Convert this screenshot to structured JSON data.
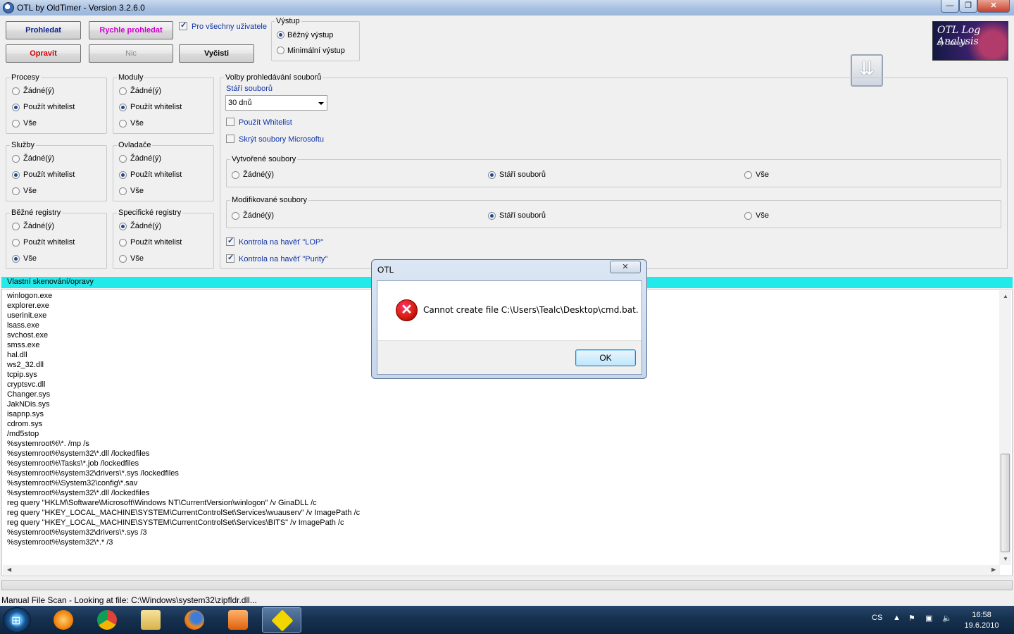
{
  "window": {
    "title": "OTL by OldTimer - Version 3.2.6.0",
    "min": "—",
    "max": "❐",
    "close": "✕"
  },
  "toolbar": {
    "prohledat": "Prohledat",
    "rychle": "Rychle prohledat",
    "opravit": "Opravit",
    "nic": "Nic",
    "vycisti": "Vyčisti",
    "all_users_label": "Pro všechny uživatele",
    "all_users_checked": true
  },
  "vystup": {
    "title": "Výstup",
    "normal": "Běžný výstup",
    "minimal": "Minimální výstup",
    "selected": "normal"
  },
  "logo": {
    "line1": "OTL Log Analysis",
    "line2": "By Oldtimer"
  },
  "groups": {
    "procesy": {
      "title": "Procesy",
      "options": [
        "Žádné(ý)",
        "Použít whitelist",
        "Vše"
      ],
      "selected": 1
    },
    "moduly": {
      "title": "Moduly",
      "options": [
        "Žádné(ý)",
        "Použít whitelist",
        "Vše"
      ],
      "selected": 1
    },
    "sluzby": {
      "title": "Služby",
      "options": [
        "Žádné(ý)",
        "Použít whitelist",
        "Vše"
      ],
      "selected": 1
    },
    "ovladace": {
      "title": "Ovladače",
      "options": [
        "Žádné(ý)",
        "Použít whitelist",
        "Vše"
      ],
      "selected": 1
    },
    "bezne": {
      "title": "Běžné registry",
      "options": [
        "Žádné(ý)",
        "Použít whitelist",
        "Vše"
      ],
      "selected": 2
    },
    "specificke": {
      "title": "Specifické registry",
      "options": [
        "Žádné(ý)",
        "Použít whitelist",
        "Vše"
      ],
      "selected": 0
    }
  },
  "file_scan": {
    "title": "Volby prohledávání souborů",
    "age_label": "Stáří souborů",
    "age_value": "30 dnů",
    "use_whitelist": "Použít Whitelist",
    "hide_ms": "Skrýt soubory Microsoftu",
    "created": {
      "title": "Vytvořené soubory",
      "options": [
        "Žádné(ý)",
        "Stáří souborů",
        "Vše"
      ],
      "selected": 1
    },
    "modified": {
      "title": "Modifikované soubory",
      "options": [
        "Žádné(ý)",
        "Stáří souborů",
        "Vše"
      ],
      "selected": 1
    },
    "lop": "Kontrola na havěť \"LOP\"",
    "purity": "Kontrola na havěť \"Purity\""
  },
  "custom_scan": {
    "title": "Vlastní skenování/opravy",
    "lines": [
      "winlogon.exe",
      "explorer.exe",
      "userinit.exe",
      "lsass.exe",
      "svchost.exe",
      "smss.exe",
      "hal.dll",
      "ws2_32.dll",
      "tcpip.sys",
      "cryptsvc.dll",
      "Changer.sys",
      "JakNDis.sys",
      "isapnp.sys",
      "cdrom.sys",
      "/md5stop",
      "%systemroot%\\*. /mp /s",
      "%systemroot%\\system32\\*.dll /lockedfiles",
      "%systemroot%\\Tasks\\*.job /lockedfiles",
      "%systemroot%\\system32\\drivers\\*.sys /lockedfiles",
      "%systemroot%\\System32\\config\\*.sav",
      "%systemroot%\\system32\\*.dll /lockedfiles",
      "reg query \"HKLM\\Software\\Microsoft\\Windows NT\\CurrentVersion\\winlogon\" /v GinaDLL /c",
      "reg query \"HKEY_LOCAL_MACHINE\\SYSTEM\\CurrentControlSet\\Services\\wuauserv\" /v ImagePath /c",
      "reg query \"HKEY_LOCAL_MACHINE\\SYSTEM\\CurrentControlSet\\Services\\BITS\" /v ImagePath /c",
      "%systemroot%\\system32\\drivers\\*.sys /3",
      "%systemroot%\\system32\\*.* /3"
    ]
  },
  "status": "Manual File Scan - Looking at file: C:\\Windows\\system32\\zipfldr.dll...",
  "dialog": {
    "title": "OTL",
    "close": "✕",
    "message": "Cannot create file C:\\Users\\Tealc\\Desktop\\cmd.bat.",
    "ok": "OK",
    "icon": "✕"
  },
  "taskbar": {
    "lang": "CS",
    "time": "16:58",
    "date": "19.6.2010"
  }
}
